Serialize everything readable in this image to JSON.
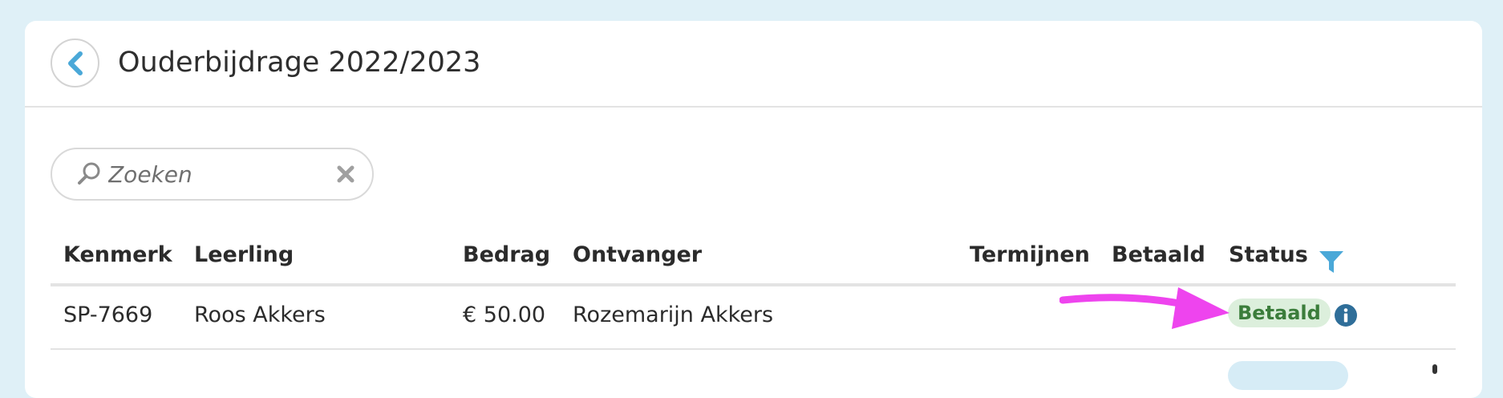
{
  "header": {
    "title": "Ouderbijdrage 2022/2023",
    "back_icon": "chevron-left-icon"
  },
  "search": {
    "placeholder": "Zoeken",
    "value": "",
    "icon": "search-icon",
    "clear_icon": "close-icon"
  },
  "table": {
    "columns": [
      "Kenmerk",
      "Leerling",
      "Bedrag",
      "Ontvanger",
      "Termijnen",
      "Betaald",
      "Status"
    ],
    "rows": [
      {
        "kenmerk": "SP-7669",
        "leerling": "Roos Akkers",
        "bedrag": "€ 50.00",
        "ontvanger": "Rozemarijn Akkers",
        "termijnen": "",
        "betaald": "",
        "status": "Betaald"
      }
    ],
    "filter_icon": "filter-icon",
    "info_icon": "info-icon"
  },
  "colors": {
    "page_background": "#dff0f7",
    "accent": "#4aa8d8",
    "status_paid_bg": "#dcefdc",
    "status_paid_text": "#3b7d3b",
    "annotation_arrow": "#ee44ee",
    "info_icon": "#2f6e99"
  }
}
